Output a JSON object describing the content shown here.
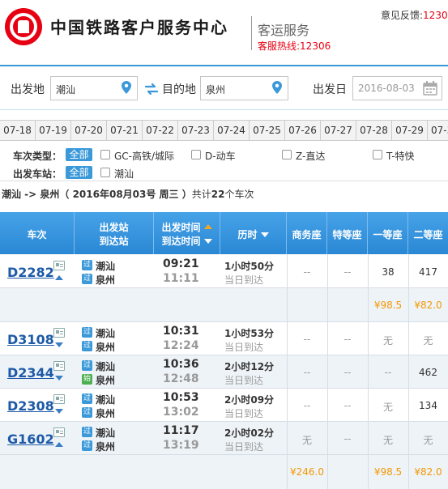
{
  "header": {
    "site_title": "中国铁路客户服务中心",
    "subtitle": "客运服务",
    "hotline": "客服热线:12306",
    "feedback_label": "意见反馈:",
    "feedback_num": "1230"
  },
  "search": {
    "from_label": "出发地",
    "from_value": "潮汕",
    "to_label": "目的地",
    "to_value": "泉州",
    "date_label": "出发日",
    "date_value": "2016-08-03"
  },
  "dates": [
    "07-18",
    "07-19",
    "07-20",
    "07-21",
    "07-22",
    "07-23",
    "07-24",
    "07-25",
    "07-26",
    "07-27",
    "07-28",
    "07-29",
    "07-3"
  ],
  "filters": {
    "type_label": "车次类型：",
    "station_label": "出发车站：",
    "all_label": "全部",
    "types": [
      "GC-高铁/城际",
      "D-动车",
      "Z-直达",
      "T-特快"
    ],
    "stations": [
      "潮汕"
    ]
  },
  "summary": {
    "route": "潮汕 -> 泉州",
    "date_text": "（ 2016年08月03号  周三 ）",
    "count_prefix": "共计",
    "count": "22",
    "count_suffix": "个车次"
  },
  "table": {
    "headers": {
      "train": "车次",
      "station_l1": "出发站",
      "station_l2": "到达站",
      "time_l1": "出发时间",
      "time_l2": "到达时间",
      "duration": "历时",
      "business": "商务座",
      "special": "特等座",
      "first": "一等座",
      "second": "二等座"
    },
    "pass_icon": "过",
    "start_icon": "始",
    "rows": [
      {
        "train": "D2282",
        "from": "潮汕",
        "to": "泉州",
        "dep": "09:21",
        "arr": "11:11",
        "duration": "1小时50分",
        "day": "当日到达",
        "business": "--",
        "special": "--",
        "first": "38",
        "second": "417",
        "expanded": true
      },
      {
        "train": "D3108",
        "from": "潮汕",
        "to": "泉州",
        "dep": "10:31",
        "arr": "12:24",
        "duration": "1小时53分",
        "day": "当日到达",
        "business": "--",
        "special": "--",
        "first": "无",
        "second": "无",
        "expanded": false
      },
      {
        "train": "D2344",
        "from": "潮汕",
        "to": "泉州",
        "dep": "10:36",
        "arr": "12:48",
        "duration": "2小时12分",
        "day": "当日到达",
        "business": "--",
        "special": "--",
        "first": "--",
        "second": "462",
        "expanded": false
      },
      {
        "train": "D2308",
        "from": "潮汕",
        "to": "泉州",
        "dep": "10:53",
        "arr": "13:02",
        "duration": "2小时09分",
        "day": "当日到达",
        "business": "--",
        "special": "--",
        "first": "无",
        "second": "134",
        "expanded": false
      },
      {
        "train": "G1602",
        "from": "潮汕",
        "to": "泉州",
        "dep": "11:17",
        "arr": "13:19",
        "duration": "2小时02分",
        "day": "当日到达",
        "business": "无",
        "special": "--",
        "first": "无",
        "second": "无",
        "expanded": true
      }
    ],
    "prices": [
      {
        "business": "",
        "first": "¥98.5",
        "second": "¥82.0"
      },
      {
        "business": "¥246.0",
        "first": "¥98.5",
        "second": "¥82.0"
      }
    ]
  }
}
